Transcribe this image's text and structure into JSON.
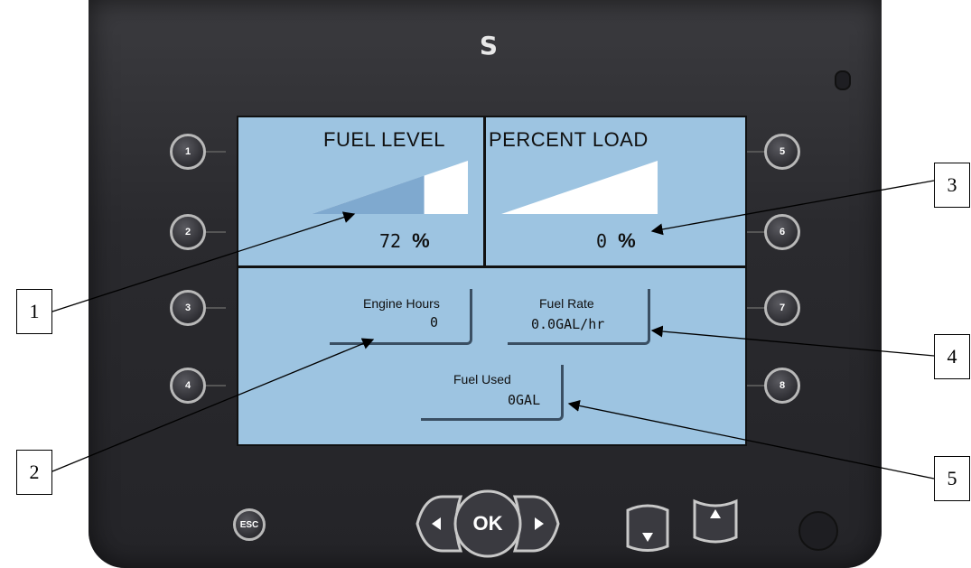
{
  "logo": "S",
  "screen": {
    "fuel_level": {
      "title": "FUEL LEVEL",
      "value": "72",
      "unit": "%",
      "fill_fraction": 0.72
    },
    "percent_load": {
      "title": "PERCENT LOAD",
      "value": "0",
      "unit": "%",
      "fill_fraction": 0.0
    },
    "engine_hours": {
      "label": "Engine Hours",
      "value": "0"
    },
    "fuel_rate": {
      "label": "Fuel Rate",
      "value": "0.0GAL/hr"
    },
    "fuel_used": {
      "label": "Fuel Used",
      "value": "0GAL"
    }
  },
  "buttons": {
    "left": [
      "1",
      "2",
      "3",
      "4"
    ],
    "right": [
      "5",
      "6",
      "7",
      "8"
    ],
    "esc": "ESC",
    "ok": "OK"
  },
  "callouts": [
    "1",
    "2",
    "3",
    "4",
    "5"
  ],
  "colors": {
    "screen_bg": "#9dc4e1",
    "bar_fill": "#7fa9cf",
    "bar_empty": "#ffffff",
    "bezel": "#2a2a2e"
  }
}
